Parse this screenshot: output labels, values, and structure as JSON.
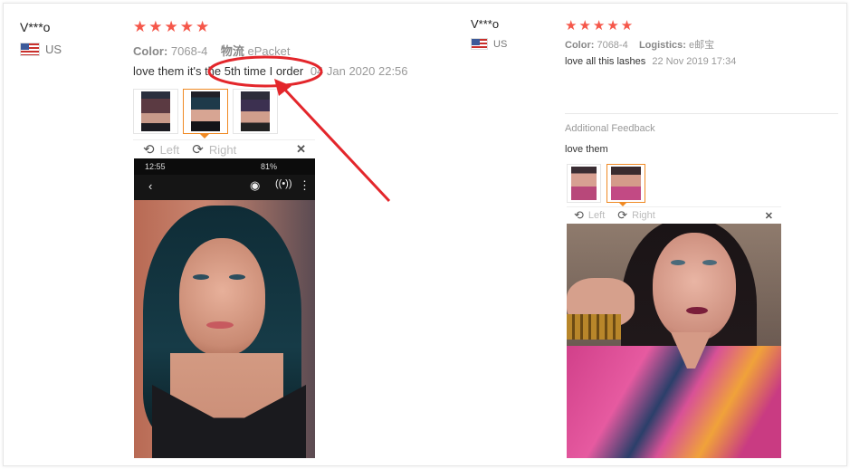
{
  "left_review": {
    "username": "V***o",
    "country": "US",
    "stars": "★★★★★",
    "color_label": "Color:",
    "color_value": "7068-4",
    "logistics_label": "物流",
    "logistics_value": "ePacket",
    "text": "love them it's the 5th time I order",
    "date": "04 Jan 2020 22:56",
    "toolbar": {
      "left": "Left",
      "right": "Right",
      "close": "✕"
    },
    "phone_status": {
      "time": "12:55",
      "battery": "81%"
    }
  },
  "right_review": {
    "username": "V***o",
    "country": "US",
    "stars": "★★★★★",
    "color_label": "Color:",
    "color_value": "7068-4",
    "logistics_label": "Logistics:",
    "logistics_value": "e邮宝",
    "text": "love all this lashes",
    "date": "22 Nov 2019 17:34",
    "additional_title": "Additional Feedback",
    "additional_text": "love them",
    "toolbar": {
      "left": "Left",
      "right": "Right",
      "close": "✕"
    }
  },
  "annotation": {
    "color": "#e3262b"
  },
  "colors": {
    "stars": "#f5574a",
    "active_thumb": "#f08a24"
  }
}
